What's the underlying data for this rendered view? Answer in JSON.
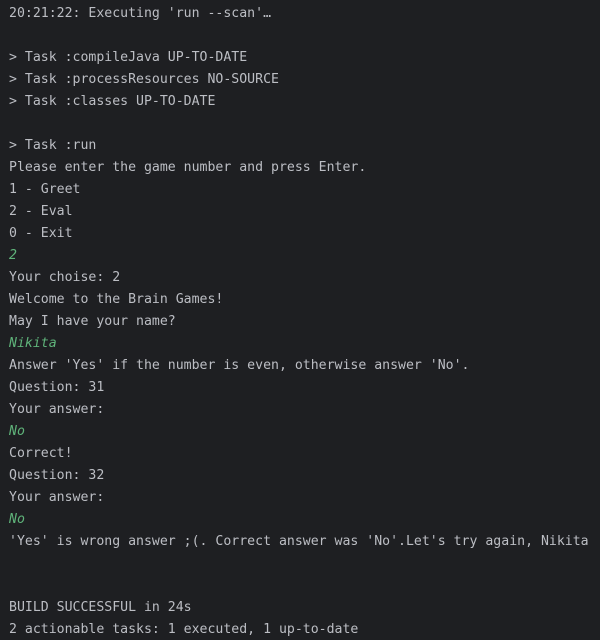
{
  "console": {
    "lines": [
      {
        "text": "20:21:22: Executing 'run --scan'…",
        "kind": "normal"
      },
      {
        "text": "",
        "kind": "blank"
      },
      {
        "text": "> Task :compileJava UP-TO-DATE",
        "kind": "normal"
      },
      {
        "text": "> Task :processResources NO-SOURCE",
        "kind": "normal"
      },
      {
        "text": "> Task :classes UP-TO-DATE",
        "kind": "normal"
      },
      {
        "text": "",
        "kind": "blank"
      },
      {
        "text": "> Task :run",
        "kind": "normal"
      },
      {
        "text": "Please enter the game number and press Enter.",
        "kind": "normal"
      },
      {
        "text": "1 - Greet",
        "kind": "normal"
      },
      {
        "text": "2 - Eval",
        "kind": "normal"
      },
      {
        "text": "0 - Exit",
        "kind": "normal"
      },
      {
        "text": "2",
        "kind": "input"
      },
      {
        "text": "Your choise: 2",
        "kind": "normal"
      },
      {
        "text": "Welcome to the Brain Games!",
        "kind": "normal"
      },
      {
        "text": "May I have your name?",
        "kind": "normal"
      },
      {
        "text": "Nikita",
        "kind": "input"
      },
      {
        "text": "Answer 'Yes' if the number is even, otherwise answer 'No'.",
        "kind": "normal"
      },
      {
        "text": "Question: 31",
        "kind": "normal"
      },
      {
        "text": "Your answer:",
        "kind": "normal"
      },
      {
        "text": "No",
        "kind": "input"
      },
      {
        "text": "Correct!",
        "kind": "normal"
      },
      {
        "text": "Question: 32",
        "kind": "normal"
      },
      {
        "text": "Your answer:",
        "kind": "normal"
      },
      {
        "text": "No",
        "kind": "input"
      },
      {
        "text": "'Yes' is wrong answer ;(. Correct answer was 'No'.Let's try again, Nikita",
        "kind": "normal"
      },
      {
        "text": "",
        "kind": "blank"
      },
      {
        "text": "",
        "kind": "blank"
      },
      {
        "text": "BUILD SUCCESSFUL in 24s",
        "kind": "normal"
      },
      {
        "text": "2 actionable tasks: 1 executed, 1 up-to-date",
        "kind": "normal"
      }
    ]
  },
  "colors": {
    "background": "#1e1f22",
    "text": "#bcbec4",
    "user_input": "#5fb37a"
  }
}
